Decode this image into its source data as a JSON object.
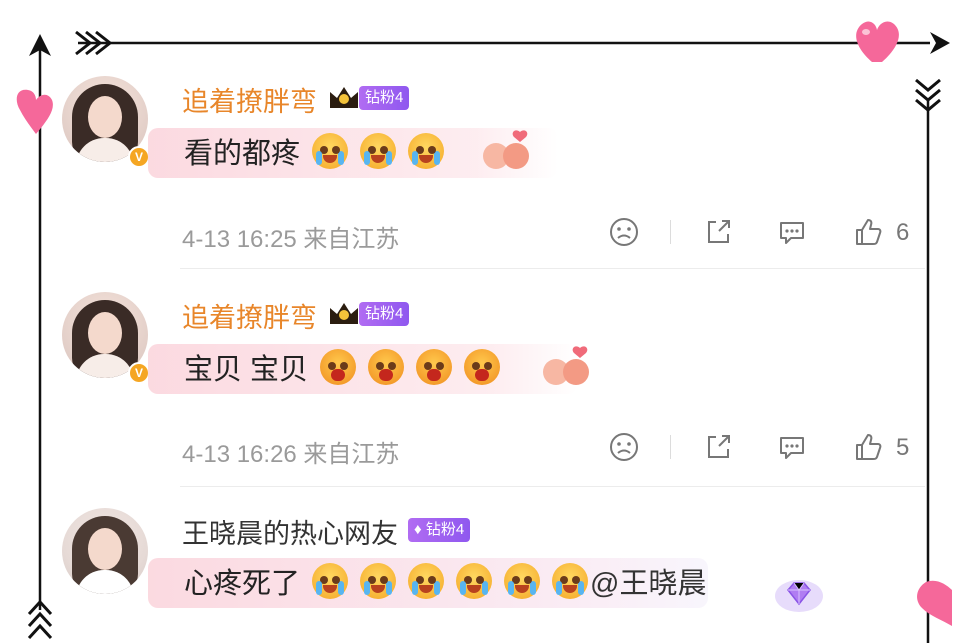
{
  "comments": [
    {
      "username": "追着撩胖弯",
      "fan_badge": "钻粉4",
      "text": "看的都疼",
      "emojis": [
        "cry",
        "cry",
        "cry"
      ],
      "time": "4-13 16:25 来自江苏",
      "likes": "6"
    },
    {
      "username": "追着撩胖弯",
      "fan_badge": "钻粉4",
      "text": "宝贝 宝贝",
      "emojis": [
        "sob",
        "sob",
        "sob",
        "sob"
      ],
      "time": "4-13 16:26 来自江苏",
      "likes": "5"
    },
    {
      "username": "王晓晨的热心网友",
      "fan_badge": "钻粉4",
      "text": "心疼死了",
      "emojis": [
        "cry",
        "cry",
        "cry",
        "tear",
        "tear",
        "tear"
      ],
      "mention": "@王晓晨"
    }
  ],
  "verified_badge": "V",
  "colors": {
    "username_orange": "#e8862a",
    "fan_badge_purple": "#9d5ff0",
    "bubble_pink": "#facdd6",
    "meta_gray": "#9a9a9a",
    "frame": "#111111",
    "heart_pink": "#f5689a"
  }
}
